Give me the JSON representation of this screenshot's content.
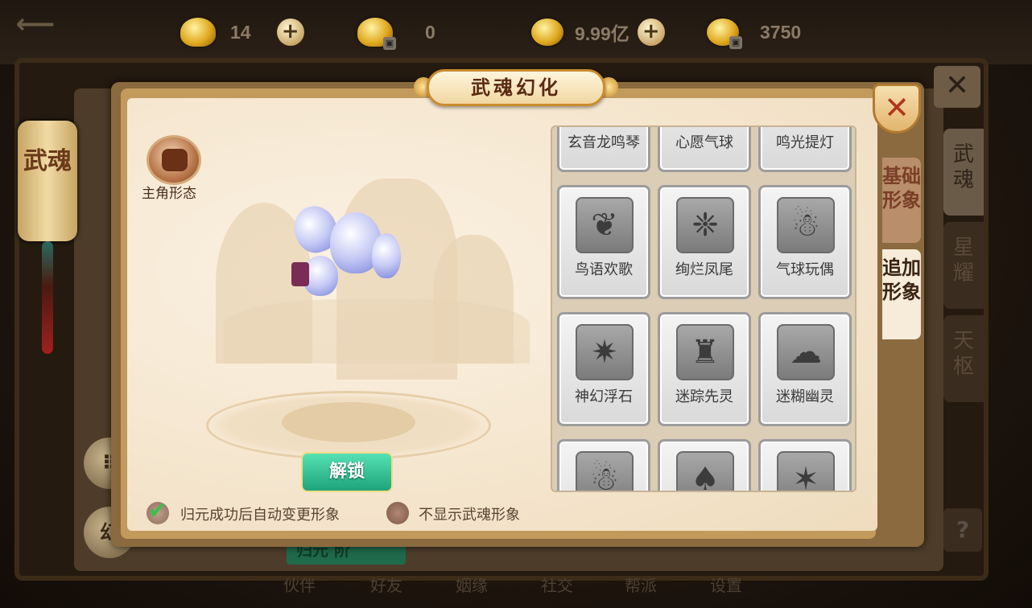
{
  "currency": {
    "gold_ingot": "14",
    "locked_ingot": "0",
    "coins": "9.99亿",
    "locked_coins": "3750"
  },
  "background": {
    "left_banner": "武魂",
    "right_tabs": [
      "武魂",
      "星耀",
      "天枢"
    ],
    "help": "?",
    "left_round_button": "幻",
    "green_button": "归元      阶",
    "bottom_nav": [
      "伙伴",
      "好友",
      "姻缘",
      "社交",
      "帮派",
      "设置"
    ]
  },
  "dialog": {
    "title": "武魂幻化",
    "close": "✕",
    "role_label": "主角形态",
    "unlock_button": "解锁",
    "option_auto_change": "归元成功后自动变更形象",
    "option_hide": "不显示武魂形象",
    "tabs": [
      "基础形象",
      "追加形象"
    ],
    "skins": [
      {
        "name": "玄音龙鸣琴",
        "icon": "lute-icon",
        "glyph": "♫"
      },
      {
        "name": "心愿气球",
        "icon": "balloon-icon",
        "glyph": "◍"
      },
      {
        "name": "鸣光提灯",
        "icon": "lantern-icon",
        "glyph": "✧"
      },
      {
        "name": "鸟语欢歌",
        "icon": "dragon-icon",
        "glyph": "❦"
      },
      {
        "name": "绚烂凤尾",
        "icon": "phoenix-tail-icon",
        "glyph": "❈"
      },
      {
        "name": "气球玩偶",
        "icon": "doll-icon",
        "glyph": "☃"
      },
      {
        "name": "神幻浮石",
        "icon": "crystal-icon",
        "glyph": "✷"
      },
      {
        "name": "迷踪先灵",
        "icon": "desk-spirit-icon",
        "glyph": "♜"
      },
      {
        "name": "迷糊幽灵",
        "icon": "ghost-icon",
        "glyph": "☁"
      },
      {
        "name": "",
        "icon": "snowman-icon",
        "glyph": "☃"
      },
      {
        "name": "",
        "icon": "pumpkin-icon",
        "glyph": "♠"
      },
      {
        "name": "",
        "icon": "star-icon",
        "glyph": "✶"
      }
    ]
  }
}
